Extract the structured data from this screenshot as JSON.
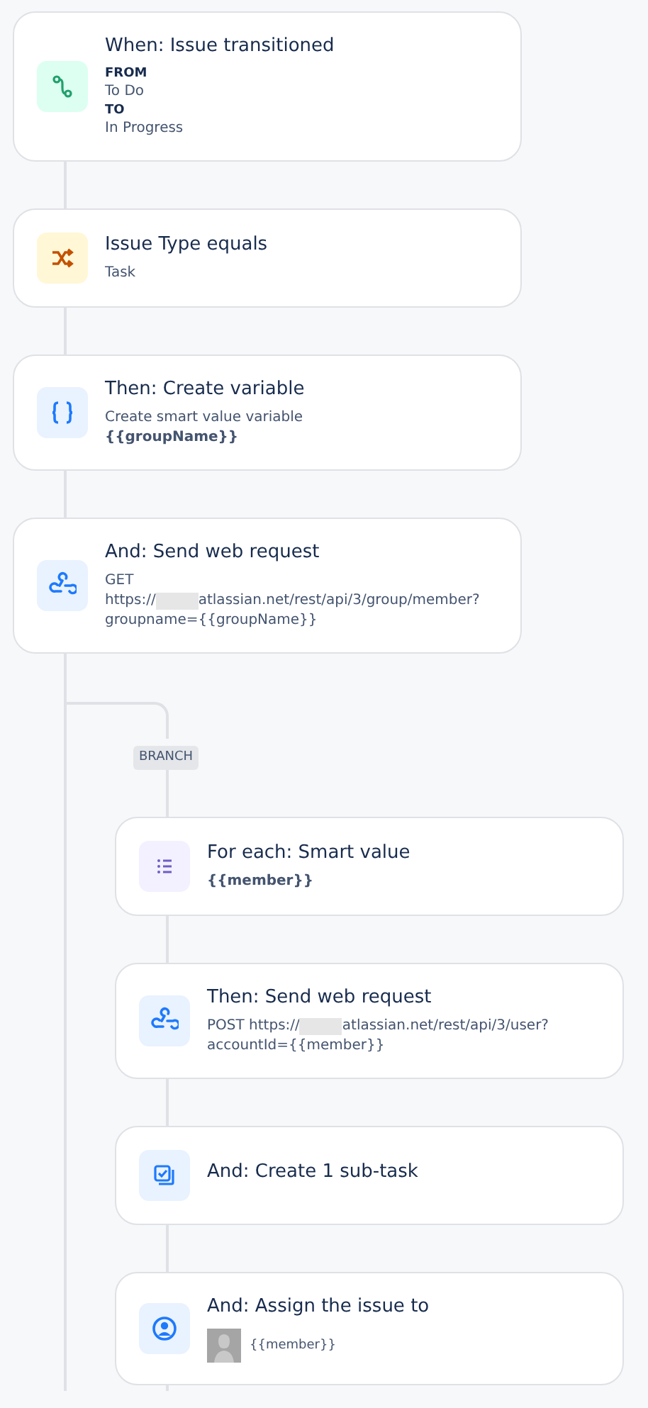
{
  "steps": [
    {
      "kind": "transition",
      "title": "When: Issue transitioned",
      "details": [
        {
          "kind": "label",
          "text": "FROM"
        },
        {
          "kind": "text",
          "text": "To Do"
        },
        {
          "kind": "label",
          "text": "TO"
        },
        {
          "kind": "text",
          "text": "In Progress"
        }
      ]
    },
    {
      "kind": "condition",
      "title": "Issue Type equals",
      "details": [
        {
          "kind": "text",
          "text": "Task"
        }
      ]
    },
    {
      "kind": "variable",
      "title": "Then: Create variable",
      "details": [
        {
          "kind": "text",
          "text": "Create smart value variable"
        },
        {
          "kind": "bold",
          "text": "{{groupName}}"
        }
      ]
    },
    {
      "kind": "webhook",
      "title": "And: Send web request",
      "details": [
        {
          "kind": "text",
          "text": "GET"
        },
        {
          "kind": "redacted",
          "before": "https://",
          "after": "atlassian.net/rest/api/3/group/member?"
        },
        {
          "kind": "text",
          "text": "groupname={{groupName}}"
        }
      ]
    }
  ],
  "branch": {
    "label": "BRANCH",
    "steps": [
      {
        "kind": "foreach",
        "title": "For each: Smart value",
        "details": [
          {
            "kind": "bold",
            "text": "{{member}}"
          }
        ]
      },
      {
        "kind": "webhook",
        "title": "Then: Send web request",
        "details": [
          {
            "kind": "redacted",
            "before": "POST https://",
            "after": "atlassian.net/rest/api/3/user?"
          },
          {
            "kind": "text",
            "text": "accountId={{member}}"
          }
        ]
      },
      {
        "kind": "subtask",
        "title": "And: Create 1 sub-task"
      },
      {
        "kind": "assign",
        "title": "And: Assign the issue to",
        "details": [
          {
            "kind": "assignee",
            "text": "{{member}}"
          }
        ]
      }
    ]
  }
}
